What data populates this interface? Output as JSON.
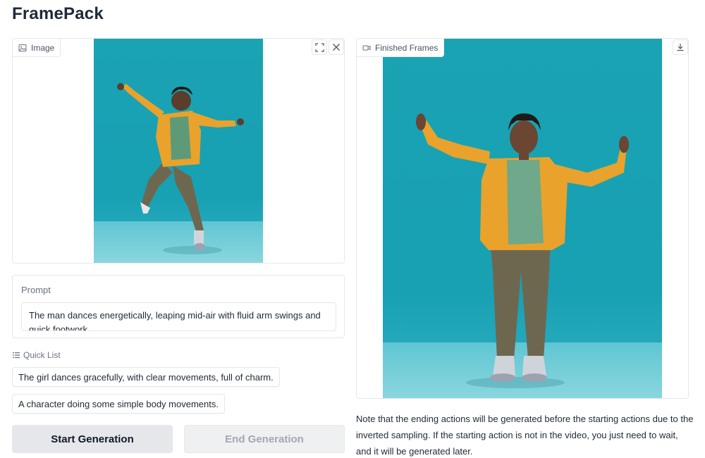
{
  "app": {
    "title": "FramePack"
  },
  "image_panel": {
    "label": "Image",
    "icons": [
      "image-icon",
      "fullscreen-icon",
      "close-icon"
    ]
  },
  "video_panel": {
    "label": "Finished Frames",
    "icons": [
      "video-camera-icon",
      "download-icon"
    ]
  },
  "prompt": {
    "label": "Prompt",
    "value": "The man dances energetically, leaping mid-air with fluid arm swings and quick footwork."
  },
  "quick_list": {
    "label": "Quick List",
    "items": [
      "The girl dances gracefully, with clear movements, full of charm.",
      "A character doing some simple body movements."
    ]
  },
  "buttons": {
    "start": "Start Generation",
    "end": "End Generation"
  },
  "note": "Note that the ending actions will be generated before the starting actions due to the inverted sampling. If the starting action is not in the video, you just need to wait, and it will be generated later.",
  "colors": {
    "backdrop": "#18a0b3",
    "jacket": "#e9a22b",
    "shirt": "#5f9a78",
    "pants": "#6e6750"
  }
}
